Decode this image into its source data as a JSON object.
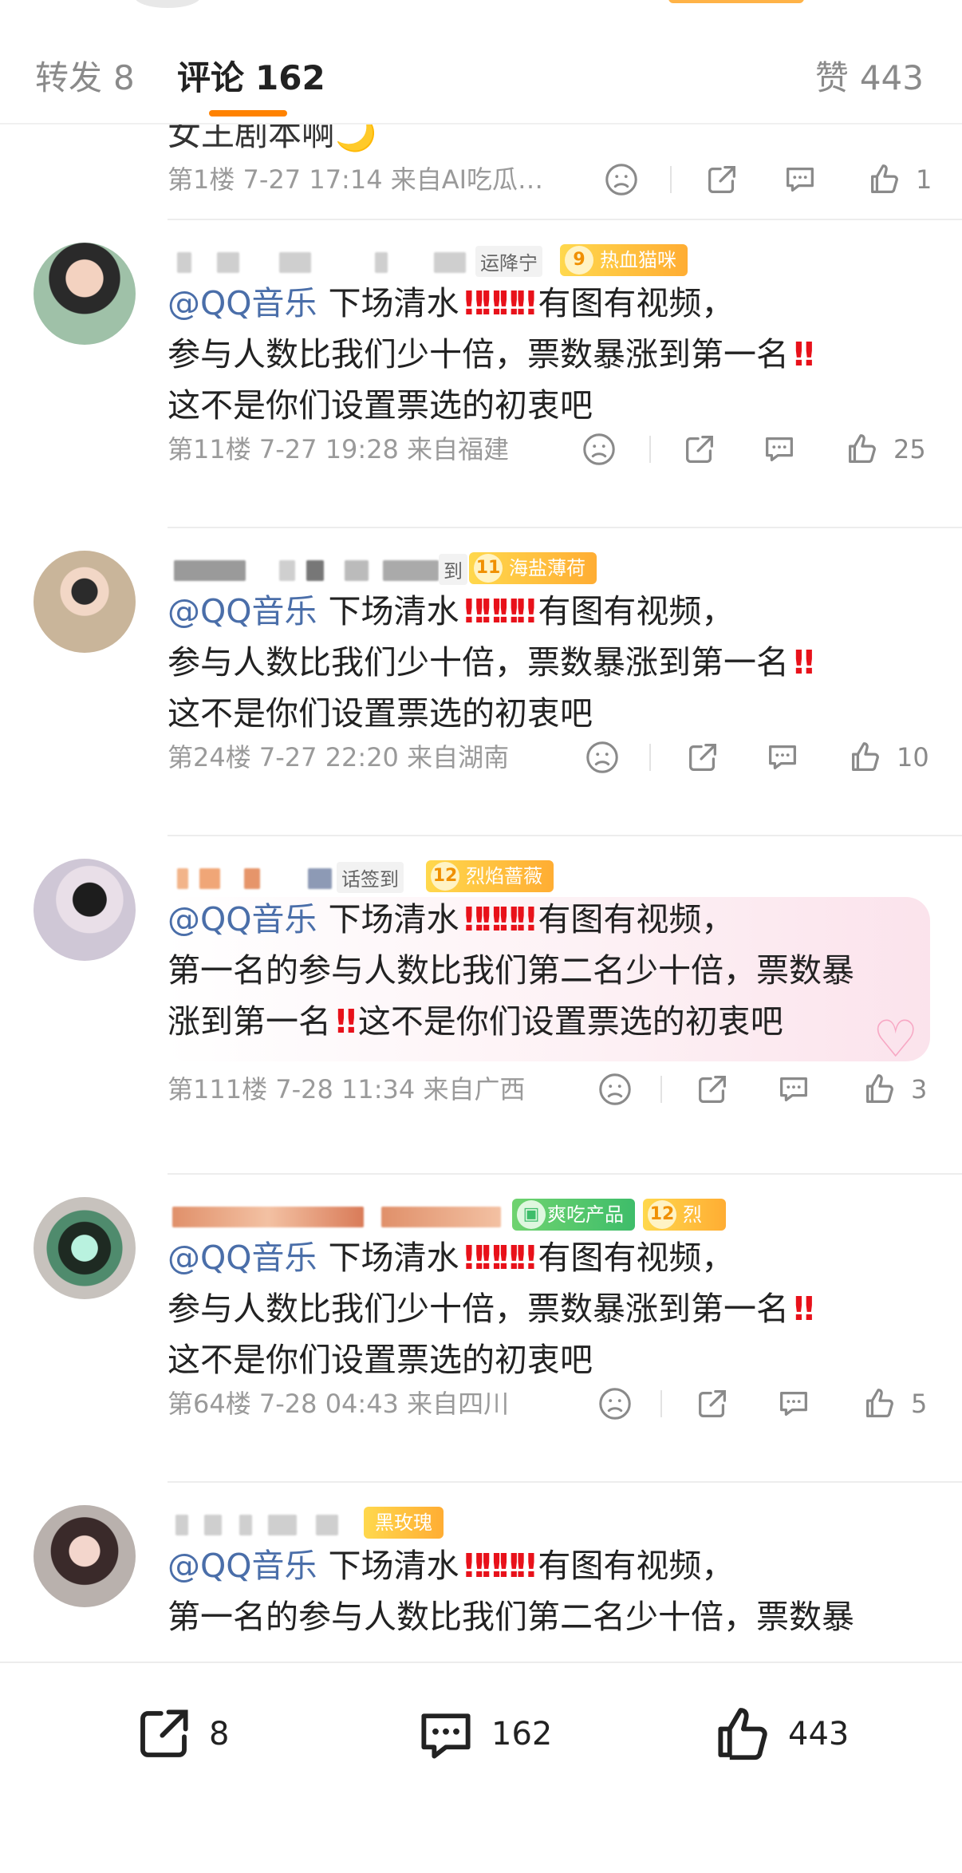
{
  "tabs": {
    "repost": {
      "label": "转发",
      "count": "8"
    },
    "comment": {
      "label": "评论",
      "count": "162"
    },
    "like": {
      "label": "赞",
      "count": "443"
    }
  },
  "first_item": {
    "partial_text": "女王剧本啊🌙",
    "meta": "第1楼 7-27 17:14 来自AI吃瓜…",
    "likes": "1"
  },
  "comments": [
    {
      "badge_prefix_text": "运降宁",
      "fan_level": "9",
      "fan_badge": "热血猫咪",
      "at": "@QQ音乐",
      "line1": "下场清水",
      "line1b": "有图有视频，",
      "line2": "参与人数比我们少十倍，票数暴涨到第一名",
      "line3": "这不是你们设置票选的初衷吧",
      "meta": "第11楼 7-27 19:28 来自福建",
      "likes": "25"
    },
    {
      "badge_prefix_text": "到",
      "fan_level": "11",
      "fan_badge": "海盐薄荷",
      "at": "@QQ音乐",
      "line1": "下场清水",
      "line1b": "有图有视频，",
      "line2": "参与人数比我们少十倍，票数暴涨到第一名",
      "line3": "这不是你们设置票选的初衷吧",
      "meta": "第24楼 7-27 22:20 来自湖南",
      "likes": "10"
    },
    {
      "badge_prefix_text": "话签到",
      "fan_level": "12",
      "fan_badge": "烈焰蔷薇",
      "at": "@QQ音乐",
      "line1": "下场清水",
      "line1b": "有图有视频，",
      "line2": "第一名的参与人数比我们第二名少十倍，票数暴",
      "line3a": "涨到第一名",
      "line3b": "这不是你们设置票选的初衷吧",
      "meta": "第111楼 7-28 11:34 来自广西",
      "likes": "3"
    },
    {
      "badge_prefix_text": "爽吃产品",
      "fan_level": "12",
      "fan_badge": "烈焰蔷薇",
      "at": "@QQ音乐",
      "line1": "下场清水",
      "line1b": "有图有视频，",
      "line2": "参与人数比我们少十倍，票数暴涨到第一名",
      "line3": "这不是你们设置票选的初衷吧",
      "meta": "第64楼 7-28 04:43 来自四川",
      "likes": "5"
    },
    {
      "fan_badge": "黑玫瑰",
      "at": "@QQ音乐",
      "line1": "下场清水",
      "line1b": "有图有视频，",
      "line2": "第一名的参与人数比我们第二名少十倍，票数暴"
    }
  ],
  "bottom_bar": {
    "repost_count": "8",
    "comment_count": "162",
    "like_count": "443"
  },
  "icons": [
    "sad-face-icon",
    "share-icon",
    "comment-icon",
    "thumbs-up-icon",
    "heart-icon"
  ],
  "colors": {
    "accent": "#ff8200",
    "mention": "#4a6ea9",
    "bang": "#e8111a",
    "meta": "#9a9a9a"
  }
}
